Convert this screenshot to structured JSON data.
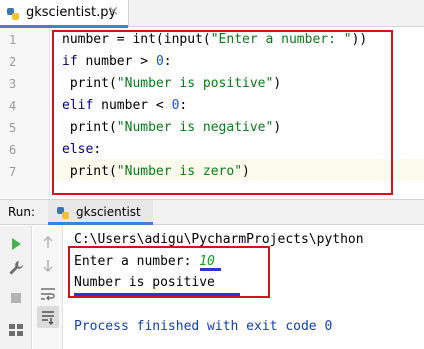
{
  "editor_tab": {
    "filename": "gkscientist.py",
    "close_glyph": "×",
    "icon": "python-file-icon"
  },
  "editor": {
    "line_numbers": [
      "1",
      "2",
      "3",
      "4",
      "5",
      "6",
      "7"
    ],
    "lines": [
      {
        "segments": [
          {
            "t": "number = int(input(",
            "c": "plain"
          },
          {
            "t": "\"Enter a number: \"",
            "c": "str"
          },
          {
            "t": "))",
            "c": "plain"
          }
        ]
      },
      {
        "segments": [
          {
            "t": "if",
            "c": "kw"
          },
          {
            "t": " number > ",
            "c": "plain"
          },
          {
            "t": "0",
            "c": "num"
          },
          {
            "t": ":",
            "c": "plain"
          }
        ]
      },
      {
        "segments": [
          {
            "t": " print(",
            "c": "plain"
          },
          {
            "t": "\"Number is positive\"",
            "c": "str"
          },
          {
            "t": ")",
            "c": "plain"
          }
        ]
      },
      {
        "segments": [
          {
            "t": "elif",
            "c": "kw"
          },
          {
            "t": " number < ",
            "c": "plain"
          },
          {
            "t": "0",
            "c": "num"
          },
          {
            "t": ":",
            "c": "plain"
          }
        ]
      },
      {
        "segments": [
          {
            "t": " print(",
            "c": "plain"
          },
          {
            "t": "\"Number is negative\"",
            "c": "str"
          },
          {
            "t": ")",
            "c": "plain"
          }
        ]
      },
      {
        "segments": [
          {
            "t": "else",
            "c": "kw"
          },
          {
            "t": ":",
            "c": "plain"
          }
        ]
      },
      {
        "segments": [
          {
            "t": " print(",
            "c": "plain"
          },
          {
            "t": "\"Number is zero\"",
            "c": "str"
          },
          {
            "t": ")",
            "c": "plain"
          }
        ]
      }
    ]
  },
  "run_panel": {
    "title": "Run:",
    "tab_label": "gkscientist",
    "tools_left": [
      "run-icon",
      "wrench-icon",
      "stop-icon",
      "layout-icon"
    ],
    "tools_right": [
      "up-arrow-icon",
      "down-arrow-icon",
      "soft-wrap-icon",
      "scroll-to-end-icon"
    ]
  },
  "console": {
    "path": "C:\\Users\\adigu\\PycharmProjects\\python",
    "prompt": "Enter a number: ",
    "input_value": "10",
    "result": "Number is positive",
    "process": "Process finished with exit code 0"
  },
  "colors": {
    "highlight_box": "#d6111f",
    "underline": "#2d36c8",
    "string": "#067d17",
    "keyword": "#000080",
    "number": "#1750eb"
  }
}
